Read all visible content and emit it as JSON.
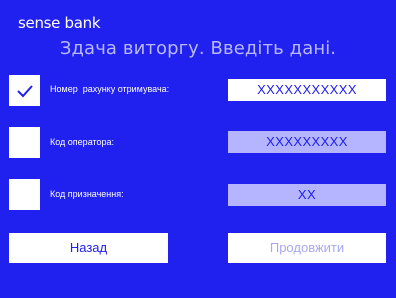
{
  "app": {
    "logo_text": "sense bank",
    "title": "Здача виторгу. Введіть дані."
  },
  "fields": [
    {
      "label": "Номер  рахунку отримувача:",
      "value": "XXXXXXXXXXX",
      "checked": true,
      "state": "active"
    },
    {
      "label": "Код оператора:",
      "value": "XXXXXXXXX",
      "checked": false,
      "state": "inactive"
    },
    {
      "label": "Код призначення:",
      "value": "XX",
      "checked": false,
      "state": "inactive"
    }
  ],
  "buttons": {
    "back_label": "Назад",
    "continue_label": "Продовжити"
  },
  "colors": {
    "background": "#2020ef",
    "title_text": "#b9b9ff",
    "active_field": "#ffffff",
    "inactive_field": "#b4b4ff",
    "disabled_text": "#a8a8f2"
  },
  "icons": {
    "check": "check-icon"
  }
}
